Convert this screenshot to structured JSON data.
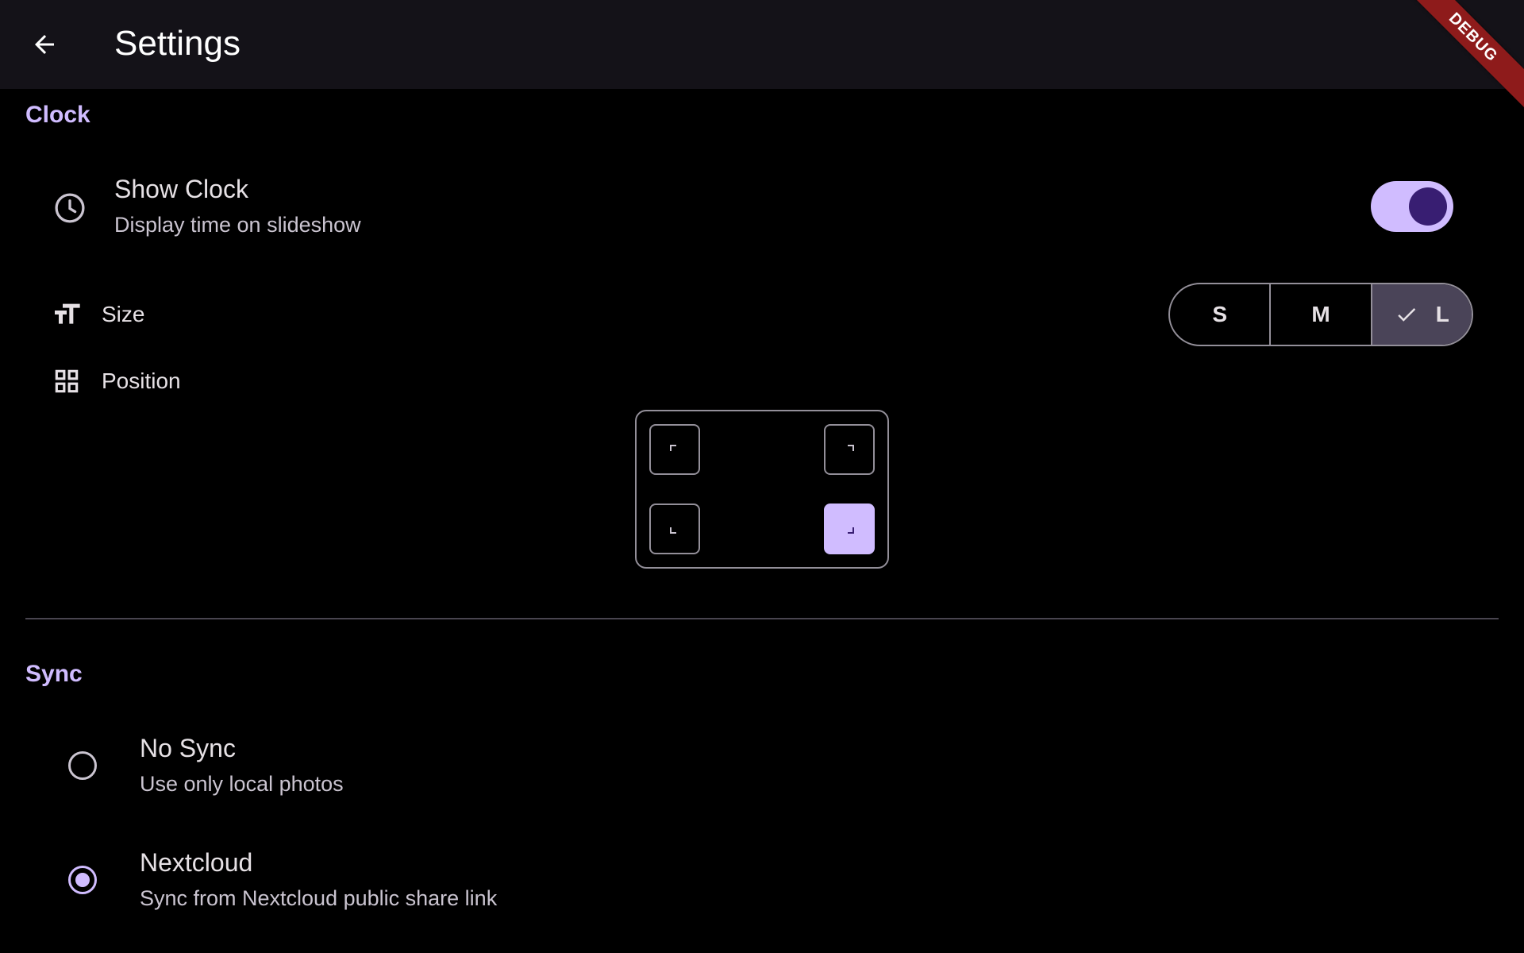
{
  "appbar": {
    "title": "Settings",
    "back_icon": "arrow-back-icon",
    "debug_banner": "DEBUG"
  },
  "clock": {
    "section_title": "Clock",
    "show_clock": {
      "icon": "clock-icon",
      "title": "Show Clock",
      "subtitle": "Display time on slideshow",
      "enabled": true
    },
    "size": {
      "icon": "text-size-icon",
      "label": "Size",
      "options": [
        "S",
        "M",
        "L"
      ],
      "selected": "L"
    },
    "position": {
      "icon": "grid-icon",
      "label": "Position",
      "options": [
        "top-left",
        "top-right",
        "bottom-left",
        "bottom-right"
      ],
      "selected": "bottom-right"
    }
  },
  "sync": {
    "section_title": "Sync",
    "options": [
      {
        "title": "No Sync",
        "subtitle": "Use only local photos",
        "checked": false
      },
      {
        "title": "Nextcloud",
        "subtitle": "Sync from Nextcloud public share link",
        "checked": true
      }
    ]
  },
  "colors": {
    "accent": "#d0bcff",
    "appbar_bg": "#141218",
    "background": "#000000",
    "debug_banner": "#8e1b1b"
  }
}
